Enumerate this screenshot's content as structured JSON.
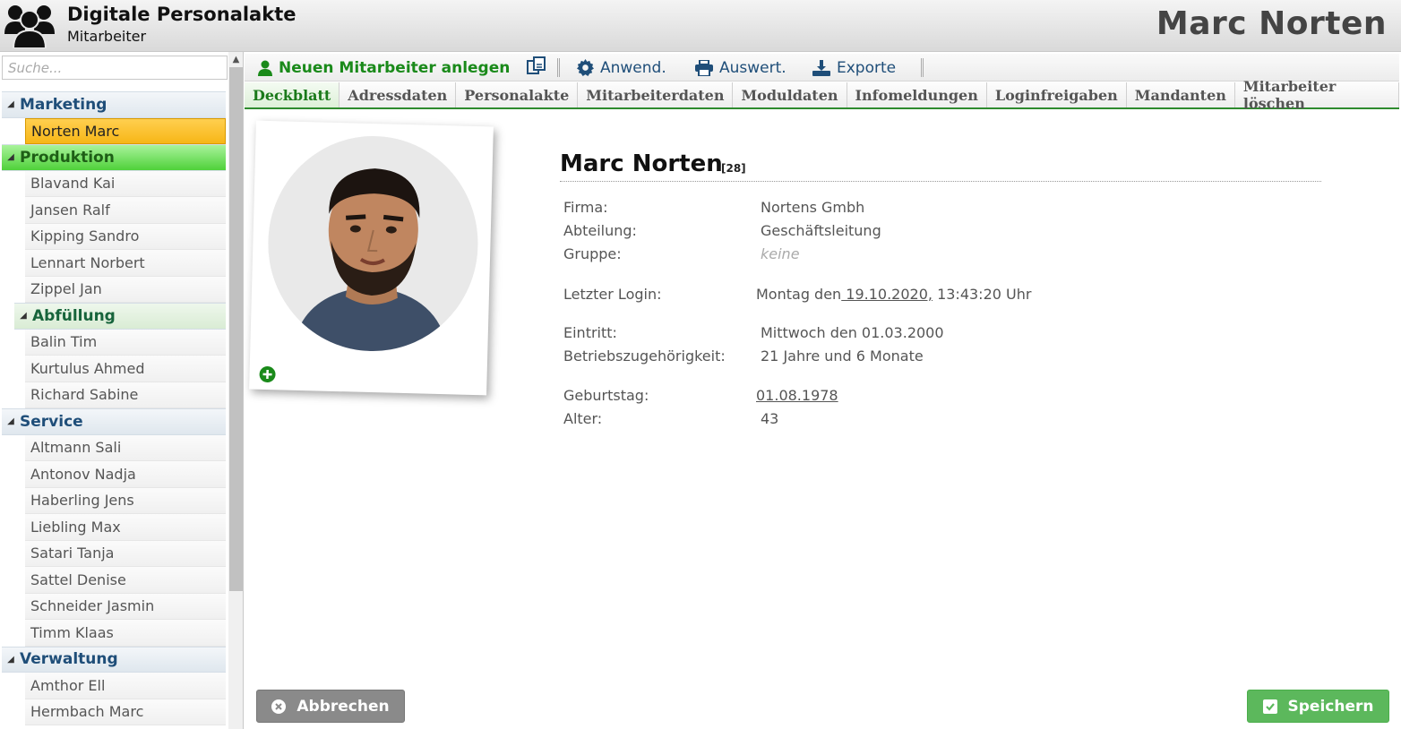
{
  "header": {
    "app_title": "Digitale Personalakte",
    "app_subtitle": "Mitarbeiter",
    "user_name": "Marc Norten",
    "logo_icon": "people-group-icon"
  },
  "sidebar": {
    "search_placeholder": "Suche...",
    "tree": [
      {
        "type": "group",
        "label": "Marketing",
        "style": "normal"
      },
      {
        "type": "item",
        "label": "Norten Marc",
        "selected": true
      },
      {
        "type": "group",
        "label": "Produktion",
        "style": "green"
      },
      {
        "type": "item",
        "label": "Blavand Kai"
      },
      {
        "type": "item",
        "label": "Jansen Ralf"
      },
      {
        "type": "item",
        "label": "Kipping Sandro"
      },
      {
        "type": "item",
        "label": "Lennart Norbert"
      },
      {
        "type": "item",
        "label": "Zippel Jan"
      },
      {
        "type": "group",
        "label": "Abfüllung",
        "style": "sub"
      },
      {
        "type": "item",
        "label": "Balin Tim"
      },
      {
        "type": "item",
        "label": "Kurtulus Ahmed"
      },
      {
        "type": "item",
        "label": "Richard Sabine"
      },
      {
        "type": "group",
        "label": "Service",
        "style": "normal"
      },
      {
        "type": "item",
        "label": "Altmann Sali"
      },
      {
        "type": "item",
        "label": "Antonov Nadja"
      },
      {
        "type": "item",
        "label": "Haberling Jens"
      },
      {
        "type": "item",
        "label": "Liebling Max"
      },
      {
        "type": "item",
        "label": "Satari Tanja"
      },
      {
        "type": "item",
        "label": "Sattel Denise"
      },
      {
        "type": "item",
        "label": "Schneider Jasmin"
      },
      {
        "type": "item",
        "label": "Timm Klaas"
      },
      {
        "type": "group",
        "label": "Verwaltung",
        "style": "normal"
      },
      {
        "type": "item",
        "label": "Amthor Ell"
      },
      {
        "type": "item",
        "label": "Hermbach Marc"
      }
    ]
  },
  "toolbar": {
    "new_employee": "Neuen Mitarbeiter anlegen",
    "applications": "Anwend.",
    "evaluations": "Auswert.",
    "exports": "Exporte"
  },
  "tabs": [
    {
      "label": "Deckblatt",
      "active": true
    },
    {
      "label": "Adressdaten"
    },
    {
      "label": "Personalakte"
    },
    {
      "label": "Mitarbeiterdaten"
    },
    {
      "label": "Moduldaten"
    },
    {
      "label": "Infomeldungen"
    },
    {
      "label": "Loginfreigaben"
    },
    {
      "label": "Mandanten"
    },
    {
      "label": "Mitarbeiter löschen"
    }
  ],
  "profile": {
    "name": "Marc Norten",
    "id": "[28]",
    "firma_label": "Firma:",
    "firma": "Nortens Gmbh",
    "abteilung_label": "Abteilung:",
    "abteilung": "Geschäftsleitung",
    "gruppe_label": "Gruppe:",
    "gruppe": "keine",
    "login_label": "Letzter Login:",
    "login_prefix": "Montag den",
    "login_date": " 19.10.2020,",
    "login_time": " 13:43:20 Uhr",
    "eintritt_label": "Eintritt:",
    "eintritt": "Mittwoch den 01.03.2000",
    "zugehoerigkeit_label": "Betriebszugehörigkeit:",
    "zugehoerigkeit": "21 Jahre und 6 Monate",
    "geburtstag_label": "Geburtstag:",
    "geburtstag": "01.08.1978",
    "alter_label": "Alter:",
    "alter": "43"
  },
  "buttons": {
    "cancel": "Abbrechen",
    "save": "Speichern"
  },
  "colors": {
    "accent_green": "#2e8b2e",
    "save_green": "#5cb85c",
    "selected_orange": "#f7b617",
    "group_blue": "#1f4e79"
  }
}
